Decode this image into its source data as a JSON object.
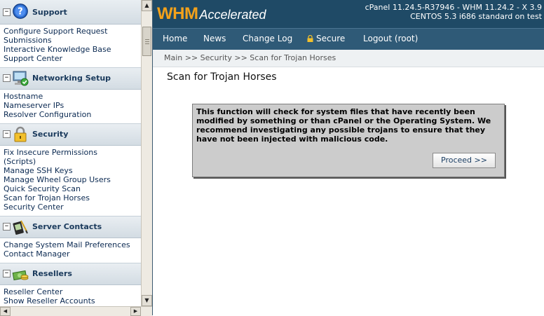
{
  "sidebar": {
    "sections": [
      {
        "title": "Support",
        "icon": "help-icon",
        "items": [
          "Configure Support Request Submissions",
          "Interactive Knowledge Base",
          "Support Center"
        ]
      },
      {
        "title": "Networking Setup",
        "icon": "network-computer-icon",
        "items": [
          "Hostname",
          "Nameserver IPs",
          "Resolver Configuration"
        ]
      },
      {
        "title": "Security",
        "icon": "padlock-icon",
        "items": [
          "Fix Insecure Permissions (Scripts)",
          "Manage SSH Keys",
          "Manage Wheel Group Users",
          "Quick Security Scan",
          "Scan for Trojan Horses",
          "Security Center"
        ]
      },
      {
        "title": "Server Contacts",
        "icon": "pda-contacts-icon",
        "items": [
          "Change System Mail Preferences",
          "Contact Manager"
        ]
      },
      {
        "title": "Resellers",
        "icon": "money-icon",
        "items": [
          "Reseller Center",
          "Show Reseller Accounts"
        ]
      }
    ],
    "toggle_symbol": "−"
  },
  "header": {
    "logo_main": "WHM",
    "logo_sub": "Accelerated",
    "version_line1": "cPanel 11.24.5-R37946 - WHM 11.24.2 - X 3.9",
    "version_line2": "CENTOS 5.3 i686 standard on test"
  },
  "nav": {
    "home": "Home",
    "news": "News",
    "changelog": "Change Log",
    "secure": "Secure",
    "logout": "Logout (root)"
  },
  "breadcrumb": "Main >> Security >> Scan for Trojan Horses",
  "page": {
    "title": "Scan for Trojan Horses",
    "info": "This function will check for system files that have recently been modified by something or than cPanel or the Operating System. We recommend investigating any possible trojans to ensure that they have not been injected with malicious code.",
    "proceed_label": "Proceed >>"
  },
  "colors": {
    "banner": "#1f4a66",
    "nav": "#2f5a77",
    "logo_orange": "#f3a21b",
    "link": "#0b2a52"
  }
}
